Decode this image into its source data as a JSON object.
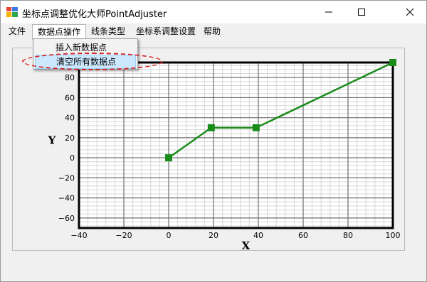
{
  "window": {
    "title": "坐标点调整优化大师PointAdjuster",
    "controls": {
      "minimize": "minimize-icon",
      "maximize": "maximize-icon",
      "close": "close-icon"
    }
  },
  "menu": {
    "items": [
      {
        "label": "文件"
      },
      {
        "label": "数据点操作"
      },
      {
        "label": "线条类型"
      },
      {
        "label": "坐标系调整设置"
      },
      {
        "label": "帮助"
      }
    ]
  },
  "dropdown": {
    "items": [
      {
        "label": "插入新数据点"
      },
      {
        "label": "清空所有数据点"
      }
    ]
  },
  "chart_data": {
    "type": "line",
    "xlabel": "X",
    "ylabel": "Y",
    "xlim": [
      -40,
      100
    ],
    "ylim": [
      -70,
      95
    ],
    "x_ticks": [
      -40,
      -20,
      0,
      20,
      40,
      60,
      80,
      100
    ],
    "y_ticks": [
      -60,
      -40,
      -20,
      0,
      20,
      40,
      60,
      80
    ],
    "x_tick_labels": [
      "−40",
      "−20",
      "0",
      "20",
      "40",
      "60",
      "80",
      "100"
    ],
    "y_tick_labels": [
      "−60",
      "−40",
      "−20",
      "0",
      "20",
      "40",
      "60",
      "80"
    ],
    "grid": true,
    "series": [
      {
        "points": [
          [
            0,
            0
          ],
          [
            19,
            30
          ],
          [
            39,
            30
          ],
          [
            100,
            95
          ]
        ],
        "color": "#1a8c1a"
      }
    ]
  },
  "colors": {
    "line": "#1a8c1a",
    "marker": "#1a8c1a",
    "grid_major": "#6e6e6e",
    "grid_minor": "#d6d6d6",
    "highlight": "#d62020",
    "selection": "#cce8ff"
  }
}
